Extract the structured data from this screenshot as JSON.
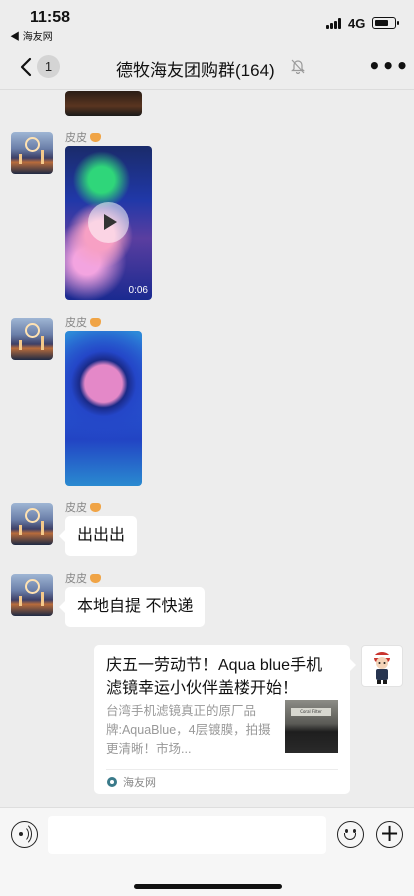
{
  "status_bar": {
    "time": "11:58",
    "back_app": "◀ 海友网",
    "network": "4G",
    "battery_fraction": 0.75
  },
  "nav": {
    "unread_count": "1",
    "title": "德牧海友团购群(164)",
    "more_label": "•••"
  },
  "messages": [
    {
      "type": "video",
      "sender": "皮皮",
      "duration": "0:06"
    },
    {
      "type": "image",
      "sender": "皮皮"
    },
    {
      "type": "text",
      "sender": "皮皮",
      "text": "出出出"
    },
    {
      "type": "text",
      "sender": "皮皮",
      "text": "本地自提 不快递"
    }
  ],
  "link_card": {
    "title": "庆五一劳动节！Aqua blue手机滤镜幸运小伙伴盖楼开始！",
    "description": "台湾手机滤镜真正的原厂品牌:AquaBlue，4层镀膜，拍摄更清晰！市场...",
    "thumb_label": "Coral Filter",
    "source": "海友网"
  },
  "input": {
    "value": ""
  },
  "colors": {
    "background": "#ededed",
    "bubble": "#ffffff",
    "secondary_text": "#888888"
  }
}
